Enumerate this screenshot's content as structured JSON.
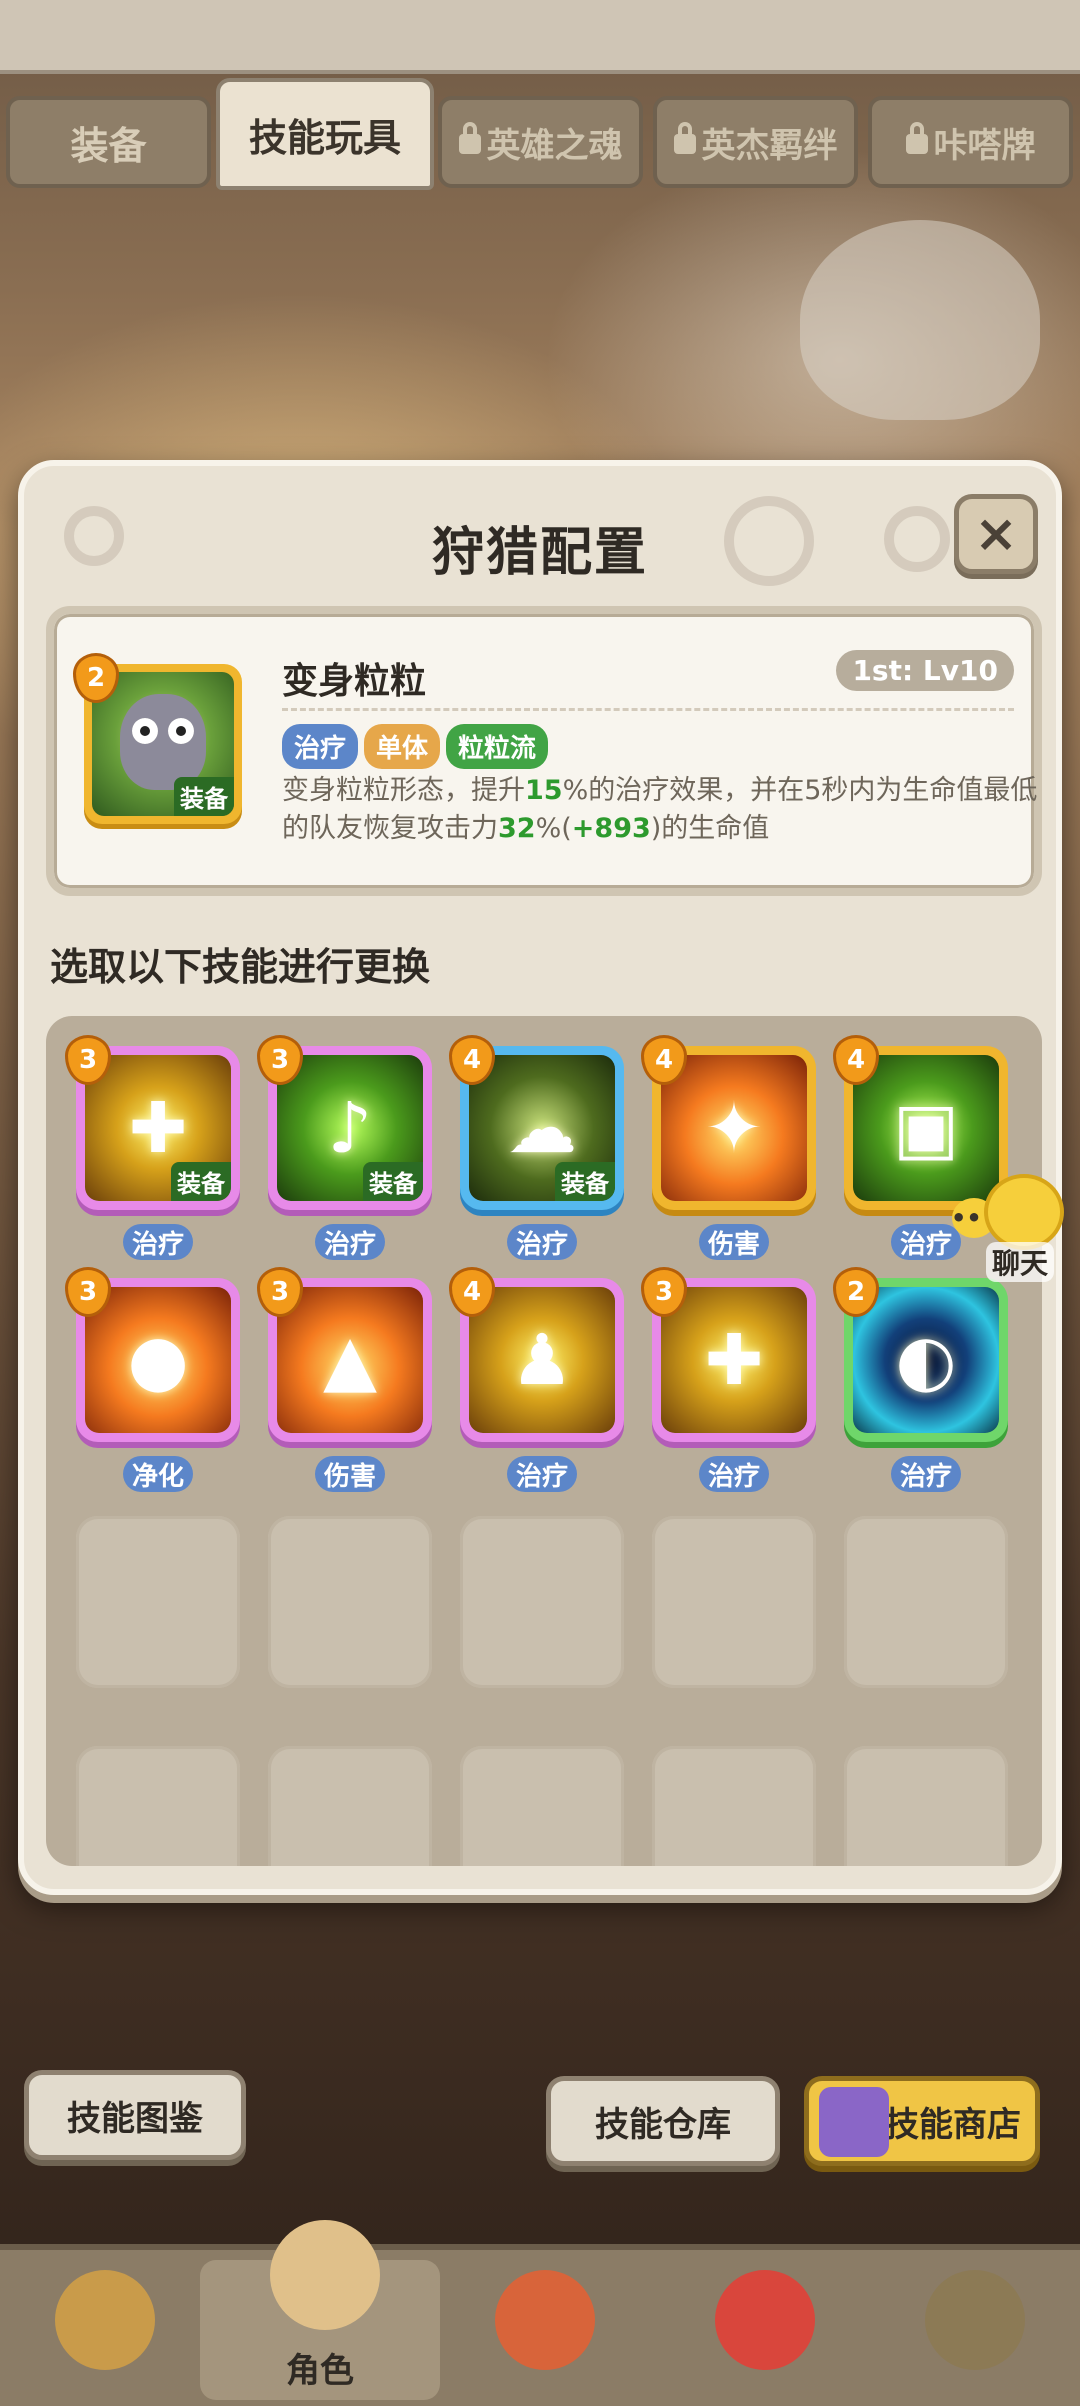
{
  "tabs": [
    {
      "label": "装备",
      "locked": false,
      "active": false
    },
    {
      "label": "技能玩具",
      "locked": false,
      "active": true
    },
    {
      "label": "英雄之魂",
      "locked": true,
      "active": false
    },
    {
      "label": "英杰羁绊",
      "locked": true,
      "active": false
    },
    {
      "label": "咔嗒牌",
      "locked": true,
      "active": false
    }
  ],
  "dialog": {
    "title": "狩猎配置",
    "close_icon": "×"
  },
  "current_skill": {
    "name": "变身粒粒",
    "level_text": "1st: Lv10",
    "star_level": "2",
    "equip_label": "装备",
    "tags": [
      "治疗",
      "单体",
      "粒粒流"
    ],
    "desc_parts": [
      "变身粒粒形态，提升",
      "15",
      "%的治疗效果，并在5秒内为生命值最低的队友恢复攻击力",
      "32",
      "%(",
      "+893",
      ")的生命值"
    ]
  },
  "section_title": "选取以下技能进行更换",
  "skills": [
    {
      "level": "3",
      "frame": "purple",
      "bg": "gold",
      "glyph": "✚",
      "label": "治疗",
      "equipped": true,
      "equip_label": "装备"
    },
    {
      "level": "3",
      "frame": "purple",
      "bg": "green",
      "glyph": "♪",
      "label": "治疗",
      "equipped": true,
      "equip_label": "装备"
    },
    {
      "level": "4",
      "frame": "blue",
      "bg": "dark-green",
      "glyph": "☁",
      "label": "治疗",
      "equipped": true,
      "equip_label": "装备"
    },
    {
      "level": "4",
      "frame": "gold",
      "bg": "orange",
      "glyph": "✦",
      "label": "伤害",
      "equipped": false
    },
    {
      "level": "4",
      "frame": "gold",
      "bg": "green",
      "glyph": "▣",
      "label": "治疗",
      "equipped": false
    },
    {
      "level": "3",
      "frame": "purple",
      "bg": "orange",
      "glyph": "●",
      "label": "净化",
      "equipped": false
    },
    {
      "level": "3",
      "frame": "purple",
      "bg": "orange",
      "glyph": "▲",
      "label": "伤害",
      "equipped": false
    },
    {
      "level": "4",
      "frame": "purple",
      "bg": "gold",
      "glyph": "♟",
      "label": "治疗",
      "equipped": false
    },
    {
      "level": "3",
      "frame": "purple",
      "bg": "gold",
      "glyph": "✚",
      "label": "治疗",
      "equipped": false
    },
    {
      "level": "2",
      "frame": "green",
      "bg": "blue",
      "glyph": "◐",
      "label": "治疗",
      "equipped": false
    }
  ],
  "buttons": {
    "codex": "技能图鉴",
    "storage": "技能仓库",
    "shop": "技能商店"
  },
  "chat": {
    "label": "聊天",
    "dots": "•••"
  },
  "bottom_nav": [
    {
      "label": "",
      "active": false,
      "face_color": "#c99b4a"
    },
    {
      "label": "角色",
      "active": true,
      "face_color": "#e0c08a"
    },
    {
      "label": "",
      "active": false,
      "face_color": "#d8643a"
    },
    {
      "label": "",
      "active": false,
      "face_color": "#d9463c"
    },
    {
      "label": "",
      "active": false,
      "face_color": "#8c7a55"
    }
  ]
}
